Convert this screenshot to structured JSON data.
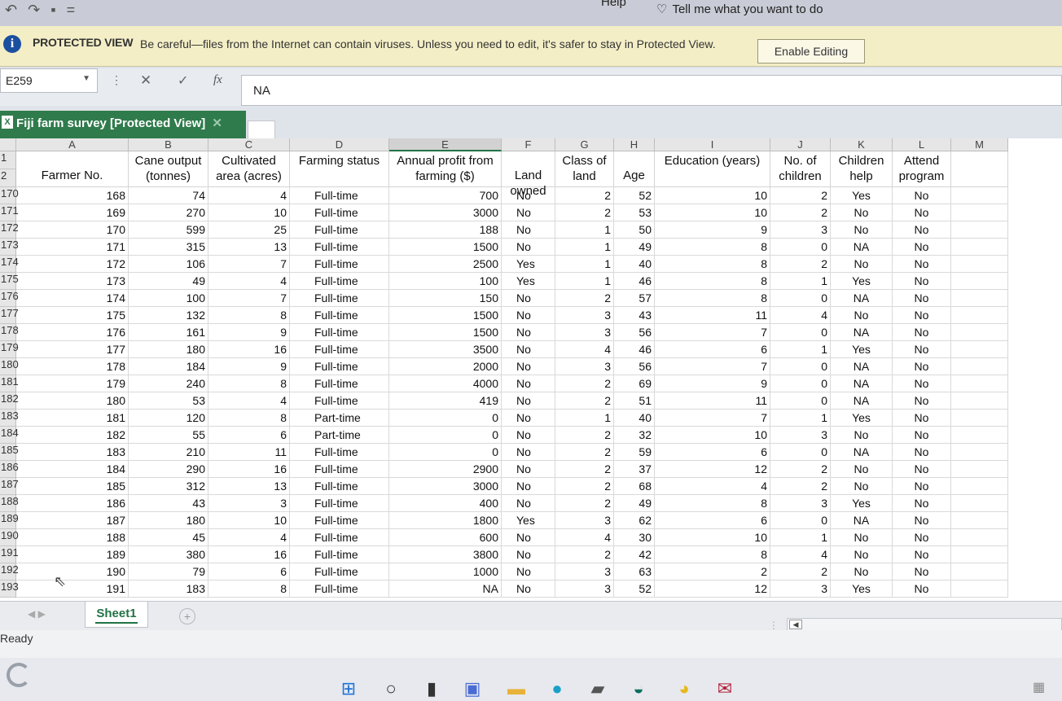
{
  "titlebar": {
    "help": "Help",
    "tell_me": "Tell me what you want to do",
    "undo": "↶",
    "redo": "↷",
    "save": "▪",
    "customize": "="
  },
  "protected_view": {
    "title": "PROTECTED VIEW",
    "message": "Be careful—files from the Internet can contain viruses. Unless you need to edit, it's safer to stay in Protected View.",
    "button": "Enable Editing",
    "icon": "info-icon"
  },
  "formula_bar": {
    "name_box": "E259",
    "fx": "fx",
    "value": "NA"
  },
  "workbook": {
    "title": "Fiji farm survey  [Protected View]"
  },
  "columns": [
    "A",
    "B",
    "C",
    "D",
    "E",
    "F",
    "G",
    "H",
    "I",
    "J",
    "K",
    "L",
    "M"
  ],
  "header_row_numbers": [
    "1",
    "2"
  ],
  "headers": {
    "A": "Farmer No.",
    "B": "Cane output (tonnes)",
    "C": "Cultivated area (acres)",
    "D": "Farming status",
    "E": "Annual profit from farming ($)",
    "F": "Land owned",
    "G": "Class of land",
    "H": "Age",
    "I": "Education (years)",
    "J": "No. of children",
    "K": "Children help",
    "L": "Attend program"
  },
  "rows": [
    {
      "n": "170",
      "c": [
        "168",
        "74",
        "4",
        "Full-time",
        "700",
        "No",
        "2",
        "52",
        "10",
        "2",
        "Yes",
        "No"
      ]
    },
    {
      "n": "171",
      "c": [
        "169",
        "270",
        "10",
        "Full-time",
        "3000",
        "No",
        "2",
        "53",
        "10",
        "2",
        "No",
        "No"
      ]
    },
    {
      "n": "172",
      "c": [
        "170",
        "599",
        "25",
        "Full-time",
        "188",
        "No",
        "1",
        "50",
        "9",
        "3",
        "No",
        "No"
      ]
    },
    {
      "n": "173",
      "c": [
        "171",
        "315",
        "13",
        "Full-time",
        "1500",
        "No",
        "1",
        "49",
        "8",
        "0",
        "NA",
        "No"
      ]
    },
    {
      "n": "174",
      "c": [
        "172",
        "106",
        "7",
        "Full-time",
        "2500",
        "Yes",
        "1",
        "40",
        "8",
        "2",
        "No",
        "No"
      ]
    },
    {
      "n": "175",
      "c": [
        "173",
        "49",
        "4",
        "Full-time",
        "100",
        "Yes",
        "1",
        "46",
        "8",
        "1",
        "Yes",
        "No"
      ]
    },
    {
      "n": "176",
      "c": [
        "174",
        "100",
        "7",
        "Full-time",
        "150",
        "No",
        "2",
        "57",
        "8",
        "0",
        "NA",
        "No"
      ]
    },
    {
      "n": "177",
      "c": [
        "175",
        "132",
        "8",
        "Full-time",
        "1500",
        "No",
        "3",
        "43",
        "11",
        "4",
        "No",
        "No"
      ]
    },
    {
      "n": "178",
      "c": [
        "176",
        "161",
        "9",
        "Full-time",
        "1500",
        "No",
        "3",
        "56",
        "7",
        "0",
        "NA",
        "No"
      ]
    },
    {
      "n": "179",
      "c": [
        "177",
        "180",
        "16",
        "Full-time",
        "3500",
        "No",
        "4",
        "46",
        "6",
        "1",
        "Yes",
        "No"
      ]
    },
    {
      "n": "180",
      "c": [
        "178",
        "184",
        "9",
        "Full-time",
        "2000",
        "No",
        "3",
        "56",
        "7",
        "0",
        "NA",
        "No"
      ]
    },
    {
      "n": "181",
      "c": [
        "179",
        "240",
        "8",
        "Full-time",
        "4000",
        "No",
        "2",
        "69",
        "9",
        "0",
        "NA",
        "No"
      ]
    },
    {
      "n": "182",
      "c": [
        "180",
        "53",
        "4",
        "Full-time",
        "419",
        "No",
        "2",
        "51",
        "11",
        "0",
        "NA",
        "No"
      ]
    },
    {
      "n": "183",
      "c": [
        "181",
        "120",
        "8",
        "Part-time",
        "0",
        "No",
        "1",
        "40",
        "7",
        "1",
        "Yes",
        "No"
      ]
    },
    {
      "n": "184",
      "c": [
        "182",
        "55",
        "6",
        "Part-time",
        "0",
        "No",
        "2",
        "32",
        "10",
        "3",
        "No",
        "No"
      ]
    },
    {
      "n": "185",
      "c": [
        "183",
        "210",
        "11",
        "Full-time",
        "0",
        "No",
        "2",
        "59",
        "6",
        "0",
        "NA",
        "No"
      ]
    },
    {
      "n": "186",
      "c": [
        "184",
        "290",
        "16",
        "Full-time",
        "2900",
        "No",
        "2",
        "37",
        "12",
        "2",
        "No",
        "No"
      ]
    },
    {
      "n": "187",
      "c": [
        "185",
        "312",
        "13",
        "Full-time",
        "3000",
        "No",
        "2",
        "68",
        "4",
        "2",
        "No",
        "No"
      ]
    },
    {
      "n": "188",
      "c": [
        "186",
        "43",
        "3",
        "Full-time",
        "400",
        "No",
        "2",
        "49",
        "8",
        "3",
        "Yes",
        "No"
      ]
    },
    {
      "n": "189",
      "c": [
        "187",
        "180",
        "10",
        "Full-time",
        "1800",
        "Yes",
        "3",
        "62",
        "6",
        "0",
        "NA",
        "No"
      ]
    },
    {
      "n": "190",
      "c": [
        "188",
        "45",
        "4",
        "Full-time",
        "600",
        "No",
        "4",
        "30",
        "10",
        "1",
        "No",
        "No"
      ]
    },
    {
      "n": "191",
      "c": [
        "189",
        "380",
        "16",
        "Full-time",
        "3800",
        "No",
        "2",
        "42",
        "8",
        "4",
        "No",
        "No"
      ]
    },
    {
      "n": "192",
      "c": [
        "190",
        "79",
        "6",
        "Full-time",
        "1000",
        "No",
        "3",
        "63",
        "2",
        "2",
        "No",
        "No"
      ]
    },
    {
      "n": "193",
      "c": [
        "191",
        "183",
        "8",
        "Full-time",
        "NA",
        "No",
        "3",
        "52",
        "12",
        "3",
        "Yes",
        "No"
      ]
    }
  ],
  "sheet_tabs": {
    "active": "Sheet1",
    "add": "+"
  },
  "status": {
    "text": "Ready"
  },
  "colors": {
    "accent": "#217346",
    "protected_bar": "#f3eec6",
    "workbook_tab": "#2f7b4c"
  }
}
